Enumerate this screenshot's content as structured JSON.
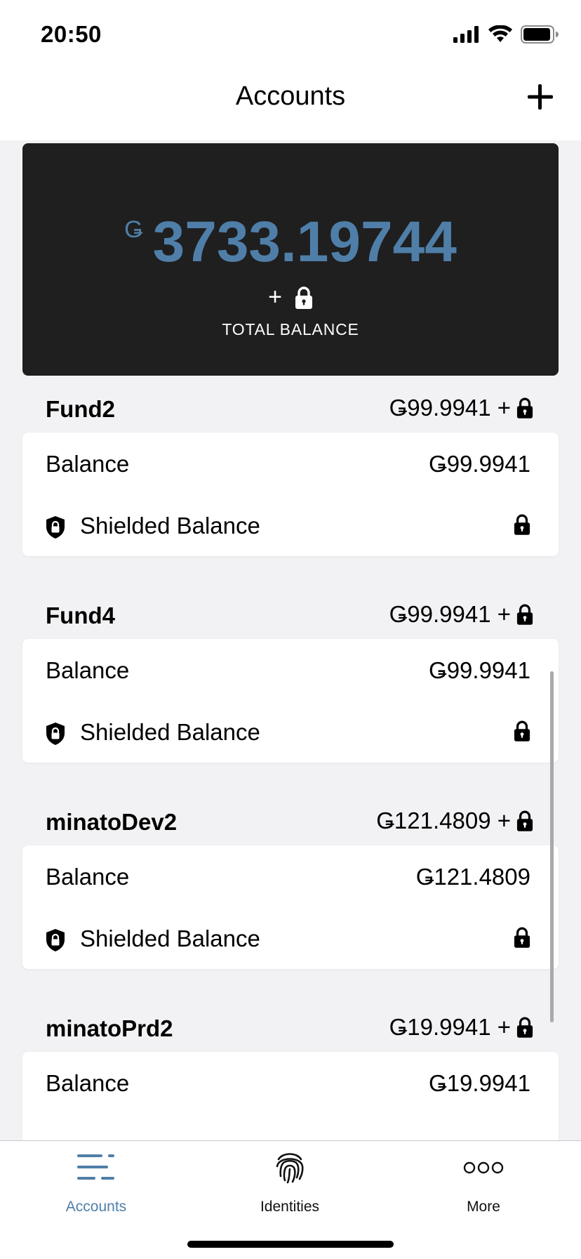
{
  "status_bar": {
    "time": "20:50"
  },
  "nav": {
    "title": "Accounts"
  },
  "total": {
    "currency": "Ǥ",
    "amount": "3733.19744",
    "plus": "+",
    "label": "TOTAL BALANCE"
  },
  "accounts": [
    {
      "name": "Fund2",
      "total": "Ǥ99.9941 +",
      "balance_label": "Balance",
      "balance": "Ǥ99.9941",
      "shielded_label": "Shielded Balance"
    },
    {
      "name": "Fund4",
      "total": "Ǥ99.9941 +",
      "balance_label": "Balance",
      "balance": "Ǥ99.9941",
      "shielded_label": "Shielded Balance"
    },
    {
      "name": "minatoDev2",
      "total": "Ǥ121.4809 +",
      "balance_label": "Balance",
      "balance": "Ǥ121.4809",
      "shielded_label": "Shielded Balance"
    },
    {
      "name": "minatoPrd2",
      "total": "Ǥ19.9941 +",
      "balance_label": "Balance",
      "balance": "Ǥ19.9941"
    }
  ],
  "tabs": [
    {
      "label": "Accounts",
      "icon": "list-icon",
      "active": true
    },
    {
      "label": "Identities",
      "icon": "fingerprint-icon",
      "active": false
    },
    {
      "label": "More",
      "icon": "more-dots-icon",
      "active": false
    }
  ],
  "colors": {
    "accent": "#4f7fa8",
    "card_dark": "#1f1f20",
    "background": "#f2f2f4"
  }
}
